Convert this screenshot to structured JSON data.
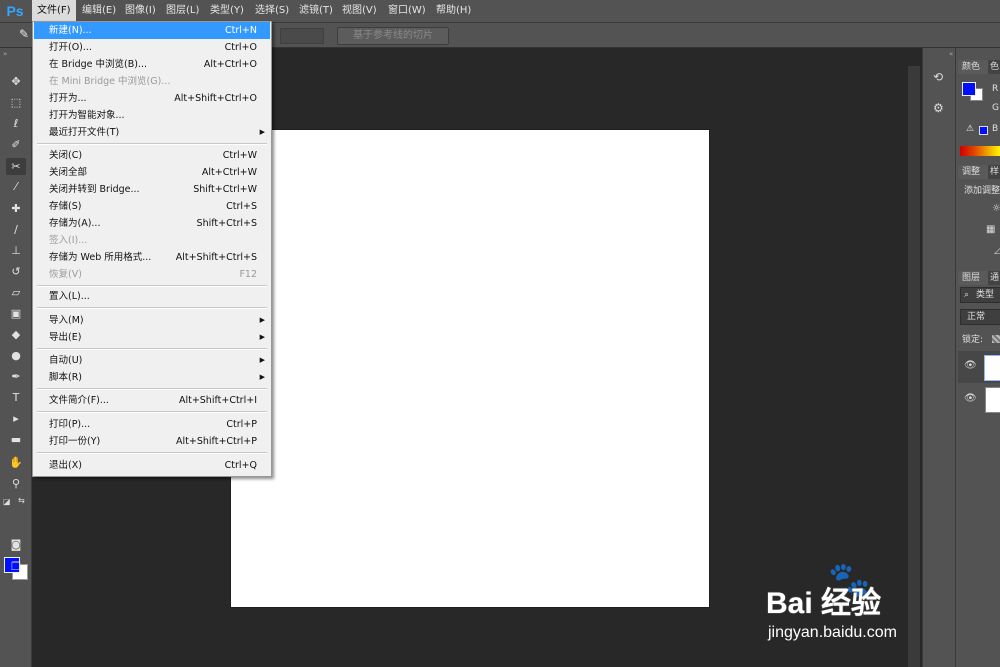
{
  "app": {
    "logo": "Ps"
  },
  "menubar": {
    "items": [
      "文件(F)",
      "编辑(E)",
      "图像(I)",
      "图层(L)",
      "类型(Y)",
      "选择(S)",
      "滤镜(T)",
      "视图(V)",
      "窗口(W)",
      "帮助(H)"
    ]
  },
  "options_bar": {
    "button_label": "基于参考线的切片"
  },
  "file_menu": {
    "items": [
      {
        "label": "新建(N)...",
        "shortcut": "Ctrl+N"
      },
      {
        "label": "打开(O)...",
        "shortcut": "Ctrl+O"
      },
      {
        "label": "在 Bridge 中浏览(B)...",
        "shortcut": "Alt+Ctrl+O"
      },
      {
        "label": "在 Mini Bridge 中浏览(G)...",
        "shortcut": ""
      },
      {
        "label": "打开为...",
        "shortcut": "Alt+Shift+Ctrl+O"
      },
      {
        "label": "打开为智能对象...",
        "shortcut": ""
      },
      {
        "label": "最近打开文件(T)",
        "shortcut": ""
      },
      {
        "label": "关闭(C)",
        "shortcut": "Ctrl+W"
      },
      {
        "label": "关闭全部",
        "shortcut": "Alt+Ctrl+W"
      },
      {
        "label": "关闭并转到 Bridge...",
        "shortcut": "Shift+Ctrl+W"
      },
      {
        "label": "存储(S)",
        "shortcut": "Ctrl+S"
      },
      {
        "label": "存储为(A)...",
        "shortcut": "Shift+Ctrl+S"
      },
      {
        "label": "签入(I)...",
        "shortcut": ""
      },
      {
        "label": "存储为 Web 所用格式...",
        "shortcut": "Alt+Shift+Ctrl+S"
      },
      {
        "label": "恢复(V)",
        "shortcut": "F12"
      },
      {
        "label": "置入(L)...",
        "shortcut": ""
      },
      {
        "label": "导入(M)",
        "shortcut": ""
      },
      {
        "label": "导出(E)",
        "shortcut": ""
      },
      {
        "label": "自动(U)",
        "shortcut": ""
      },
      {
        "label": "脚本(R)",
        "shortcut": ""
      },
      {
        "label": "文件简介(F)...",
        "shortcut": "Alt+Shift+Ctrl+I"
      },
      {
        "label": "打印(P)...",
        "shortcut": "Ctrl+P"
      },
      {
        "label": "打印一份(Y)",
        "shortcut": "Alt+Shift+Ctrl+P"
      },
      {
        "label": "退出(X)",
        "shortcut": "Ctrl+Q"
      }
    ]
  },
  "right_panel": {
    "color_tabs": [
      "颜色",
      "色"
    ],
    "channel_r": "R",
    "channel_g": "G",
    "channel_b": "B",
    "adjust_tabs": [
      "调整",
      "样"
    ],
    "adjust_title": "添加调整",
    "layers_tabs": [
      "图层",
      "通"
    ],
    "layer_filter": "类型",
    "blend_mode": "正常",
    "lock_label": "锁定:"
  },
  "watermark": {
    "main": "Bai 经验",
    "sub": "jingyan.baidu.com"
  },
  "colors": {
    "foreground": "#0010ff",
    "background": "#ffffff",
    "menu_highlight": "#3399ff",
    "ps_blue": "#31a8ff"
  }
}
